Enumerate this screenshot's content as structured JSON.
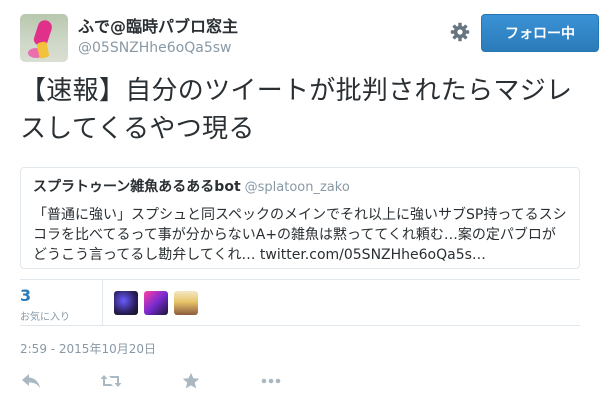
{
  "user": {
    "display_name": "ふで@臨時パブロ窓主",
    "screen_name": "@05SNZHhe6oQa5sw",
    "follow_button_label": "フォロー中"
  },
  "tweet": {
    "text": "【速報】自分のツイートが批判されたらマジレスしてくるやつ現る"
  },
  "quoted_tweet": {
    "name": "スプラトゥーン雑魚あるあるbot",
    "screen_name": "@splatoon_zako",
    "text": "「普通に強い」スプシュと同スペックのメインでそれ以上に強いサブSP持ってるスシコラを比べてるって事が分からないA+の雑魚は黙っててくれ頼む…案の定パブロがどうこう言ってるし勘弁してくれ… twitter.com/05SNZHhe6oQa5s…"
  },
  "stats": {
    "favorites_count": "3",
    "favorites_label": "お気に入り"
  },
  "timestamp": "2:59 - 2015年10月20日",
  "icons": {
    "settings": "gear-icon",
    "reply": "reply-icon",
    "retweet": "retweet-icon",
    "favorite": "star-icon",
    "more": "more-icon"
  },
  "colors": {
    "accent": "#2b7bb9",
    "muted": "#8899a6",
    "text": "#292f33",
    "border": "#e1e8ed",
    "action_icon": "#aab8c2"
  }
}
